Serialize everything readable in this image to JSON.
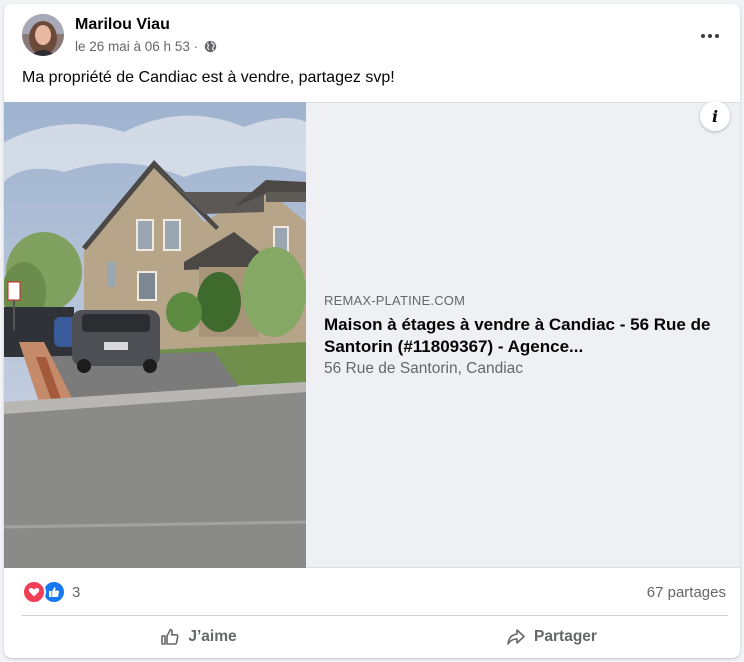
{
  "post": {
    "author": "Marilou Viau",
    "timestamp": "le 26 mai à 06 h 53 ·",
    "audience_icon": "globe-icon",
    "text": "Ma propriété de Candiac est à vendre, partagez svp!"
  },
  "link_preview": {
    "domain": "REMAX-PLATINE.COM",
    "title": "Maison à étages à vendre à Candiac - 56 Rue de Santorin (#11809367) - Agence...",
    "description": "56 Rue de Santorin, Candiac",
    "info_label": "i"
  },
  "stats": {
    "reaction_count": "3",
    "reaction_icons": [
      "love-icon",
      "like-icon"
    ],
    "shares": "67 partages"
  },
  "actions": {
    "like_label": "J’aime",
    "share_label": "Partager"
  },
  "colors": {
    "like_blue": "#1877f2",
    "love_red": "#f33e58",
    "secondary_text": "#65676b"
  }
}
